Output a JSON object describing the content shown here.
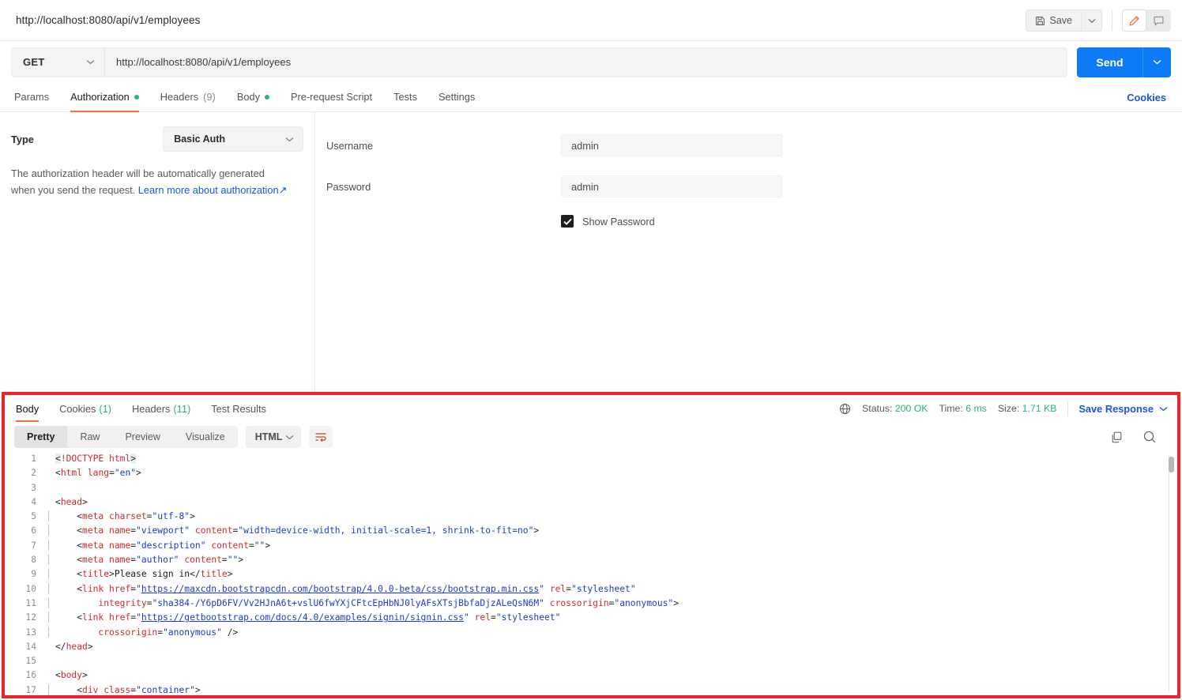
{
  "window": {
    "request_title": "http://localhost:8080/api/v1/employees"
  },
  "toolbar": {
    "save_label": "Save",
    "save_caret": "chevron-down",
    "edit_icon": "pencil-icon",
    "comment_icon": "comment-icon"
  },
  "request": {
    "method": "GET",
    "url": "http://localhost:8080/api/v1/employees",
    "send_label": "Send"
  },
  "request_tabs": {
    "items": [
      {
        "label": "Params",
        "badge": "",
        "dot": false,
        "active": false
      },
      {
        "label": "Authorization",
        "badge": "",
        "dot": true,
        "active": true
      },
      {
        "label": "Headers",
        "badge": "(9)",
        "dot": false,
        "active": false
      },
      {
        "label": "Body",
        "badge": "",
        "dot": true,
        "active": false
      },
      {
        "label": "Pre-request Script",
        "badge": "",
        "dot": false,
        "active": false
      },
      {
        "label": "Tests",
        "badge": "",
        "dot": false,
        "active": false
      },
      {
        "label": "Settings",
        "badge": "",
        "dot": false,
        "active": false
      }
    ],
    "cookies_link": "Cookies"
  },
  "auth": {
    "type_label": "Type",
    "type_value": "Basic Auth",
    "note_text": "The authorization header will be automatically generated when you send the request. ",
    "note_link": "Learn more about authorization",
    "note_link_arrow": "↗",
    "username_label": "Username",
    "username_value": "admin",
    "password_label": "Password",
    "password_value": "admin",
    "show_password_label": "Show Password",
    "show_password_checked": true
  },
  "response": {
    "tabs": [
      {
        "label": "Body",
        "count": "",
        "active": true
      },
      {
        "label": "Cookies",
        "count": "(1)",
        "active": false
      },
      {
        "label": "Headers",
        "count": "(11)",
        "active": false
      },
      {
        "label": "Test Results",
        "count": "",
        "active": false
      }
    ],
    "globe_icon": "globe-icon",
    "status_label": "Status:",
    "status_value": "200 OK",
    "time_label": "Time:",
    "time_value": "6 ms",
    "size_label": "Size:",
    "size_value": "1.71 KB",
    "save_response_label": "Save Response",
    "view_modes": [
      {
        "label": "Pretty",
        "active": true
      },
      {
        "label": "Raw",
        "active": false
      },
      {
        "label": "Preview",
        "active": false
      },
      {
        "label": "Visualize",
        "active": false
      }
    ],
    "format": "HTML",
    "wrap_icon": "word-wrap-icon",
    "copy_icon": "copy-icon",
    "search_icon": "search-icon"
  },
  "code": {
    "language": "html",
    "lines": [
      {
        "n": "1",
        "indent": 0,
        "tokens": [
          {
            "t": "punct",
            "v": "<",
            "hl": true
          },
          {
            "t": "tag",
            "v": "!DOCTYPE html"
          },
          {
            "t": "punct",
            "v": ">",
            "hl": true
          }
        ]
      },
      {
        "n": "2",
        "indent": 0,
        "tokens": [
          {
            "t": "punct",
            "v": "<"
          },
          {
            "t": "tag",
            "v": "html"
          },
          {
            "t": "text",
            "v": " "
          },
          {
            "t": "attr",
            "v": "lang"
          },
          {
            "t": "punct",
            "v": "="
          },
          {
            "t": "val",
            "v": "\"en\""
          },
          {
            "t": "punct",
            "v": ">"
          }
        ]
      },
      {
        "n": "3",
        "indent": 0,
        "tokens": []
      },
      {
        "n": "4",
        "indent": 0,
        "tokens": [
          {
            "t": "punct",
            "v": "<"
          },
          {
            "t": "tag",
            "v": "head"
          },
          {
            "t": "punct",
            "v": ">"
          }
        ]
      },
      {
        "n": "5",
        "indent": 1,
        "tokens": [
          {
            "t": "punct",
            "v": "    <"
          },
          {
            "t": "tag",
            "v": "meta"
          },
          {
            "t": "text",
            "v": " "
          },
          {
            "t": "attr",
            "v": "charset"
          },
          {
            "t": "punct",
            "v": "="
          },
          {
            "t": "val",
            "v": "\"utf-8\""
          },
          {
            "t": "punct",
            "v": ">"
          }
        ]
      },
      {
        "n": "6",
        "indent": 1,
        "tokens": [
          {
            "t": "punct",
            "v": "    <"
          },
          {
            "t": "tag",
            "v": "meta"
          },
          {
            "t": "text",
            "v": " "
          },
          {
            "t": "attr",
            "v": "name"
          },
          {
            "t": "punct",
            "v": "="
          },
          {
            "t": "val",
            "v": "\"viewport\""
          },
          {
            "t": "text",
            "v": " "
          },
          {
            "t": "attr",
            "v": "content"
          },
          {
            "t": "punct",
            "v": "="
          },
          {
            "t": "val",
            "v": "\"width=device-width, initial-scale=1, shrink-to-fit=no\""
          },
          {
            "t": "punct",
            "v": ">"
          }
        ]
      },
      {
        "n": "7",
        "indent": 1,
        "tokens": [
          {
            "t": "punct",
            "v": "    <"
          },
          {
            "t": "tag",
            "v": "meta"
          },
          {
            "t": "text",
            "v": " "
          },
          {
            "t": "attr",
            "v": "name"
          },
          {
            "t": "punct",
            "v": "="
          },
          {
            "t": "val",
            "v": "\"description\""
          },
          {
            "t": "text",
            "v": " "
          },
          {
            "t": "attr",
            "v": "content"
          },
          {
            "t": "punct",
            "v": "="
          },
          {
            "t": "val",
            "v": "\"\""
          },
          {
            "t": "punct",
            "v": ">"
          }
        ]
      },
      {
        "n": "8",
        "indent": 1,
        "tokens": [
          {
            "t": "punct",
            "v": "    <"
          },
          {
            "t": "tag",
            "v": "meta"
          },
          {
            "t": "text",
            "v": " "
          },
          {
            "t": "attr",
            "v": "name"
          },
          {
            "t": "punct",
            "v": "="
          },
          {
            "t": "val",
            "v": "\"author\""
          },
          {
            "t": "text",
            "v": " "
          },
          {
            "t": "attr",
            "v": "content"
          },
          {
            "t": "punct",
            "v": "="
          },
          {
            "t": "val",
            "v": "\"\""
          },
          {
            "t": "punct",
            "v": ">"
          }
        ]
      },
      {
        "n": "9",
        "indent": 1,
        "tokens": [
          {
            "t": "punct",
            "v": "    <"
          },
          {
            "t": "tag",
            "v": "title"
          },
          {
            "t": "punct",
            "v": ">"
          },
          {
            "t": "text",
            "v": "Please sign in"
          },
          {
            "t": "punct",
            "v": "</"
          },
          {
            "t": "tag",
            "v": "title"
          },
          {
            "t": "punct",
            "v": ">"
          }
        ]
      },
      {
        "n": "10",
        "indent": 1,
        "tokens": [
          {
            "t": "punct",
            "v": "    <"
          },
          {
            "t": "tag",
            "v": "link"
          },
          {
            "t": "text",
            "v": " "
          },
          {
            "t": "attr",
            "v": "href"
          },
          {
            "t": "punct",
            "v": "="
          },
          {
            "t": "val",
            "v": "\""
          },
          {
            "t": "link",
            "v": "https://maxcdn.bootstrapcdn.com/bootstrap/4.0.0-beta/css/bootstrap.min.css"
          },
          {
            "t": "val",
            "v": "\""
          },
          {
            "t": "text",
            "v": " "
          },
          {
            "t": "attr",
            "v": "rel"
          },
          {
            "t": "punct",
            "v": "="
          },
          {
            "t": "val",
            "v": "\"stylesheet\""
          }
        ]
      },
      {
        "n": "11",
        "indent": 2,
        "tokens": [
          {
            "t": "punct",
            "v": "        "
          },
          {
            "t": "attr",
            "v": "integrity"
          },
          {
            "t": "punct",
            "v": "="
          },
          {
            "t": "val",
            "v": "\"sha384-/Y6pD6FV/Vv2HJnA6t+vslU6fwYXjCFtcEpHbNJ0lyAFsXTsjBbfaDjzALeQsN6M\""
          },
          {
            "t": "text",
            "v": " "
          },
          {
            "t": "attr",
            "v": "crossorigin"
          },
          {
            "t": "punct",
            "v": "="
          },
          {
            "t": "val",
            "v": "\"anonymous\""
          },
          {
            "t": "punct",
            "v": ">"
          }
        ]
      },
      {
        "n": "12",
        "indent": 1,
        "tokens": [
          {
            "t": "punct",
            "v": "    <"
          },
          {
            "t": "tag",
            "v": "link"
          },
          {
            "t": "text",
            "v": " "
          },
          {
            "t": "attr",
            "v": "href"
          },
          {
            "t": "punct",
            "v": "="
          },
          {
            "t": "val",
            "v": "\""
          },
          {
            "t": "link",
            "v": "https://getbootstrap.com/docs/4.0/examples/signin/signin.css"
          },
          {
            "t": "val",
            "v": "\""
          },
          {
            "t": "text",
            "v": " "
          },
          {
            "t": "attr",
            "v": "rel"
          },
          {
            "t": "punct",
            "v": "="
          },
          {
            "t": "val",
            "v": "\"stylesheet\""
          }
        ]
      },
      {
        "n": "13",
        "indent": 2,
        "tokens": [
          {
            "t": "punct",
            "v": "        "
          },
          {
            "t": "attr",
            "v": "crossorigin"
          },
          {
            "t": "punct",
            "v": "="
          },
          {
            "t": "val",
            "v": "\"anonymous\""
          },
          {
            "t": "text",
            "v": " "
          },
          {
            "t": "punct",
            "v": "/>"
          }
        ]
      },
      {
        "n": "14",
        "indent": 0,
        "tokens": [
          {
            "t": "punct",
            "v": "</"
          },
          {
            "t": "tag",
            "v": "head"
          },
          {
            "t": "punct",
            "v": ">"
          }
        ]
      },
      {
        "n": "15",
        "indent": 0,
        "tokens": []
      },
      {
        "n": "16",
        "indent": 0,
        "tokens": [
          {
            "t": "punct",
            "v": "<"
          },
          {
            "t": "tag",
            "v": "body"
          },
          {
            "t": "punct",
            "v": ">"
          }
        ]
      },
      {
        "n": "17",
        "indent": 1,
        "tokens": [
          {
            "t": "punct",
            "v": "    <"
          },
          {
            "t": "tag",
            "v": "div"
          },
          {
            "t": "text",
            "v": " "
          },
          {
            "t": "attr",
            "v": "class"
          },
          {
            "t": "punct",
            "v": "="
          },
          {
            "t": "val",
            "v": "\"container\""
          },
          {
            "t": "punct",
            "v": ">"
          }
        ]
      }
    ]
  },
  "colors": {
    "accent_orange": "#ff6c37",
    "send_blue": "#0d7bf5",
    "link_blue": "#1a55e8",
    "success_green": "#2bb673",
    "highlight_border": "#ee2228"
  }
}
